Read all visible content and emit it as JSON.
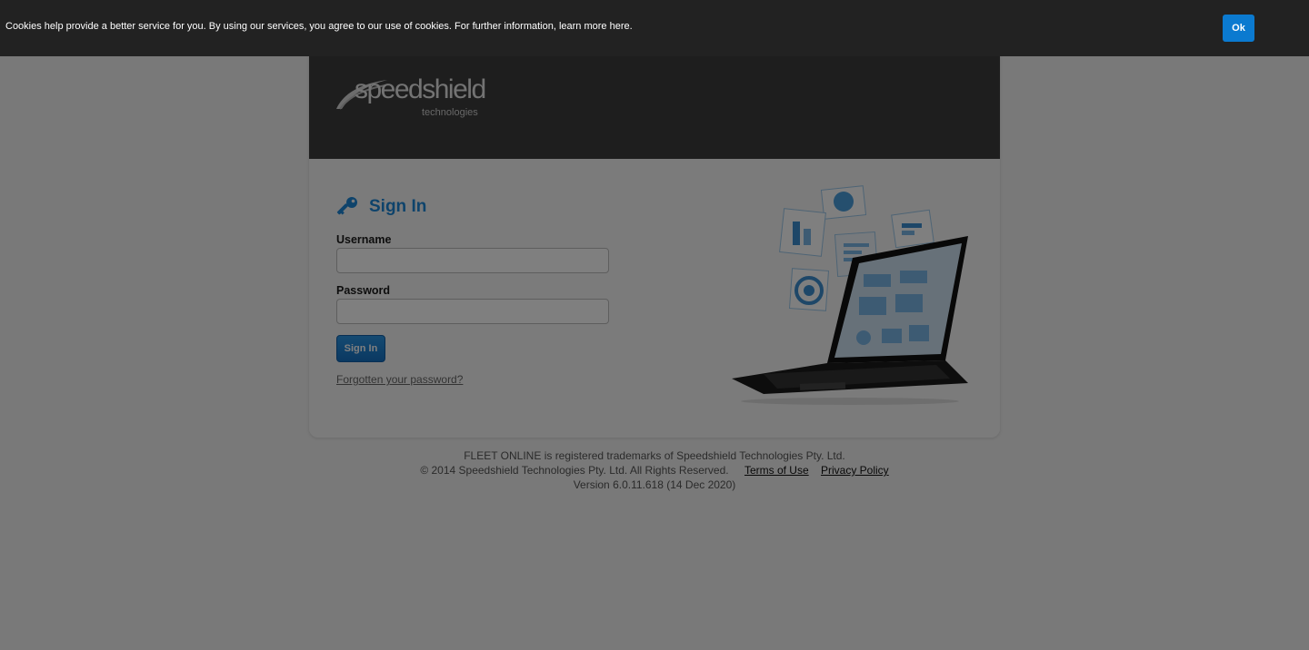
{
  "cookie_banner": {
    "message": "Cookies help provide a better service for you. By using our services, you agree to our use of cookies. For further information, learn more here.",
    "ok_label": "Ok"
  },
  "brand": {
    "logo_word": "speedshield",
    "logo_sub": "technologies"
  },
  "signin": {
    "title": "Sign In",
    "username_label": "Username",
    "username_value": "",
    "password_label": "Password",
    "password_value": "",
    "button_label": "Sign In",
    "forgot_link": "Forgotten your password?"
  },
  "footer": {
    "trademark": "FLEET ONLINE is registered trademarks of Speedshield Technologies Pty. Ltd.",
    "copyright": "© 2014 Speedshield Technologies Pty. Ltd. All Rights Reserved.",
    "terms_link": "Terms of Use",
    "privacy_link": "Privacy Policy",
    "version": "Version 6.0.11.618 (14 Dec 2020)"
  },
  "colors": {
    "accent": "#1d87d6",
    "header_bg": "#3d3d3d",
    "cookie_bar_bg": "#222222",
    "ok_button": "#0b7ad0"
  },
  "icons": {
    "signin_icon": "key-icon",
    "hero": "laptop-dashboard-illustration"
  }
}
